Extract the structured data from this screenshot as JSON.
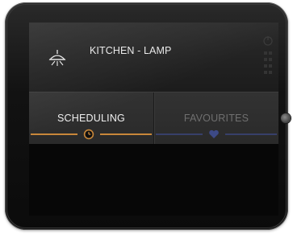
{
  "device": {
    "title": "KITCHEN - LAMP",
    "icon": "ceiling-lamp-icon"
  },
  "tabs": [
    {
      "label": "SCHEDULING",
      "icon": "clock-icon",
      "active": true,
      "accent": "#c8873a"
    },
    {
      "label": "FAVOURITES",
      "icon": "heart-icon",
      "active": false,
      "accent": "#37406a"
    }
  ],
  "side_icons": [
    "power-icon",
    "grid-icon"
  ]
}
